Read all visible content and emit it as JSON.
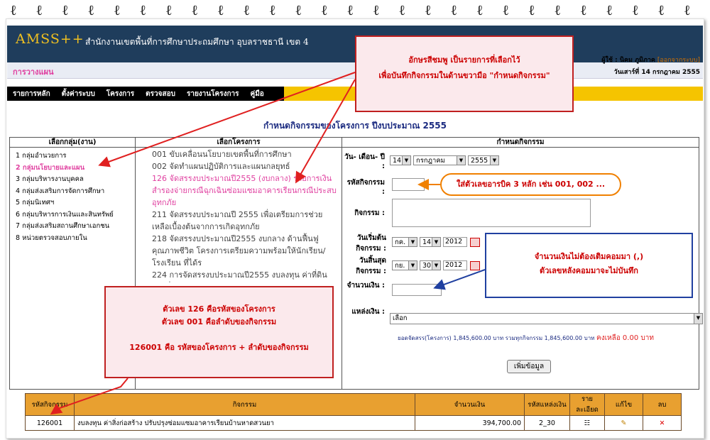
{
  "header": {
    "logo": "AMSS++",
    "org_name": "สำนักงานเขตพื้นที่การศึกษาประถมศึกษา อุบลราชธานี เขต 4",
    "user_label": "ผู้ใช้ : นิคม ภูมิภาค",
    "logout": "[ออกจากระบบ]",
    "date": "วันเสาร์ที่ 14 กรกฎาคม 2555",
    "section": "การวางแผน"
  },
  "menu": [
    "รายการหลัก",
    "ตั้งค่าระบบ",
    "โครงการ",
    "ตรวจสอบ",
    "รายงานโครงการ",
    "คู่มือ"
  ],
  "page_title": "กำหนดกิจกรรมของโครงการ ปีงบประมาณ 2555",
  "columns": {
    "groups": "เลือกกลุ่ม(งาน)",
    "projects": "เลือกโครงการ",
    "activity": "กำหนดกิจกรรม"
  },
  "groups": [
    "1 กลุ่มอำนวยการ",
    "2 กลุ่มนโยบายและแผน",
    "3 กลุ่มบริหารงานบุคคล",
    "4 กลุ่มส่งเสริมการจัดการศึกษา",
    "5 กลุ่มนิเทศฯ",
    "6 กลุ่มบริหารการเงินและสินทรัพย์",
    "7 กลุ่มส่งเสริมสถานศึกษาเอกชน",
    "8 หน่วยตรวจสอบภายใน"
  ],
  "projects": [
    "001 ขับเคลื่อนนโยบายเขตพื้นที่การศึกษา",
    "002 จัดทำแผนปฏิบัติการและแผนกลยุทธ์",
    "126 จัดสรรงบประมาณปี2555 (งบกลาง) รายการเงินสำรองจ่ายกรณีฉุกเฉินซ่อมแซมอาคารเรียนกรณีประสบอุทกภัย",
    "211 จัดสรรงบประมาณปี 2555 เพื่อเตรียมการช่วยเหลือเบื้องต้นจากการเกิดอุทกภัย",
    "218 จัดสรรงบประมาณปี2555 งบกลาง ด้านฟื้นฟูคุณภาพชีวิต โครงการเตรียมความพร้อมให้นักเรียน/โรงเรียน ที่ได้ร",
    "224 การจัดสรรงบประมาณปี2555 งบลงทุน ค่าที่ดินและสิ่งก่อสร้าง"
  ],
  "form": {
    "date_label": "วัน- เดือน- ปี :",
    "day": "14",
    "month": "กรกฎาคม",
    "year": "2555",
    "code_label": "รหัสกิจกรรม :",
    "activity_label": "กิจกรรม :",
    "start_label": "วันเริ่มต้นกิจกรรม :",
    "start_month": "กค.",
    "start_day": "14",
    "start_year": "2012",
    "end_label": "วันสิ้นสุดกิจกรรม :",
    "end_month": "กย.",
    "end_day": "30",
    "end_year": "2012",
    "amount_label": "จำนวนเงิน :",
    "source_label": "แหล่งเงิน :",
    "source_value": "เลือก",
    "summary": "ยอดจัดสรร(โครงการ) 1,845,600.00 บาท รวมทุกกิจกรรม 1,845,600.00 บาท",
    "remaining": "คงเหลือ 0.00 บาท",
    "add_button": "เพิ่มข้อมูล"
  },
  "table": {
    "headers": [
      "รหัสกิจกรรม",
      "กิจกรรม",
      "จำนวนเงิน",
      "รหัสแหล่งเงิน",
      "รายละเอียด",
      "แก้ไข",
      "ลบ"
    ],
    "rows": [
      {
        "code": "126001",
        "activity": "งบลงทุน ค่าสิ่งก่อสร้าง ปรับปรุงซ่อมแซมอาคารเรียนบ้านหาดสวนยา",
        "amount": "394,700.00",
        "source": "2_30"
      }
    ]
  },
  "callouts": {
    "c1_line1": "อักษรสีชมพู เป็นรายการที่เลือกไว้",
    "c1_line2": "เพื่อบันทึกกิจกรรมในด้านขวามือ \"กำหนดกิจกรรม\"",
    "c2": "ใส่ตัวเลขอารบิค 3 หลัก เช่น 001, 002 ...",
    "c3_line1": "จำนวนเงินไม่ต้องเติมคอมมา (,)",
    "c3_line2": "ตัวเลขหลังคอมมาจะไม่บันทึก",
    "c4_line1": "ตัวเลข 126 คือรหัสของโครงการ",
    "c4_line2": "ตัวเลข 001 คือลำดับของกิจกรรม",
    "c4_line3": "126001 คือ รหัสของโครงการ + ลำดับของกิจกรรม"
  }
}
